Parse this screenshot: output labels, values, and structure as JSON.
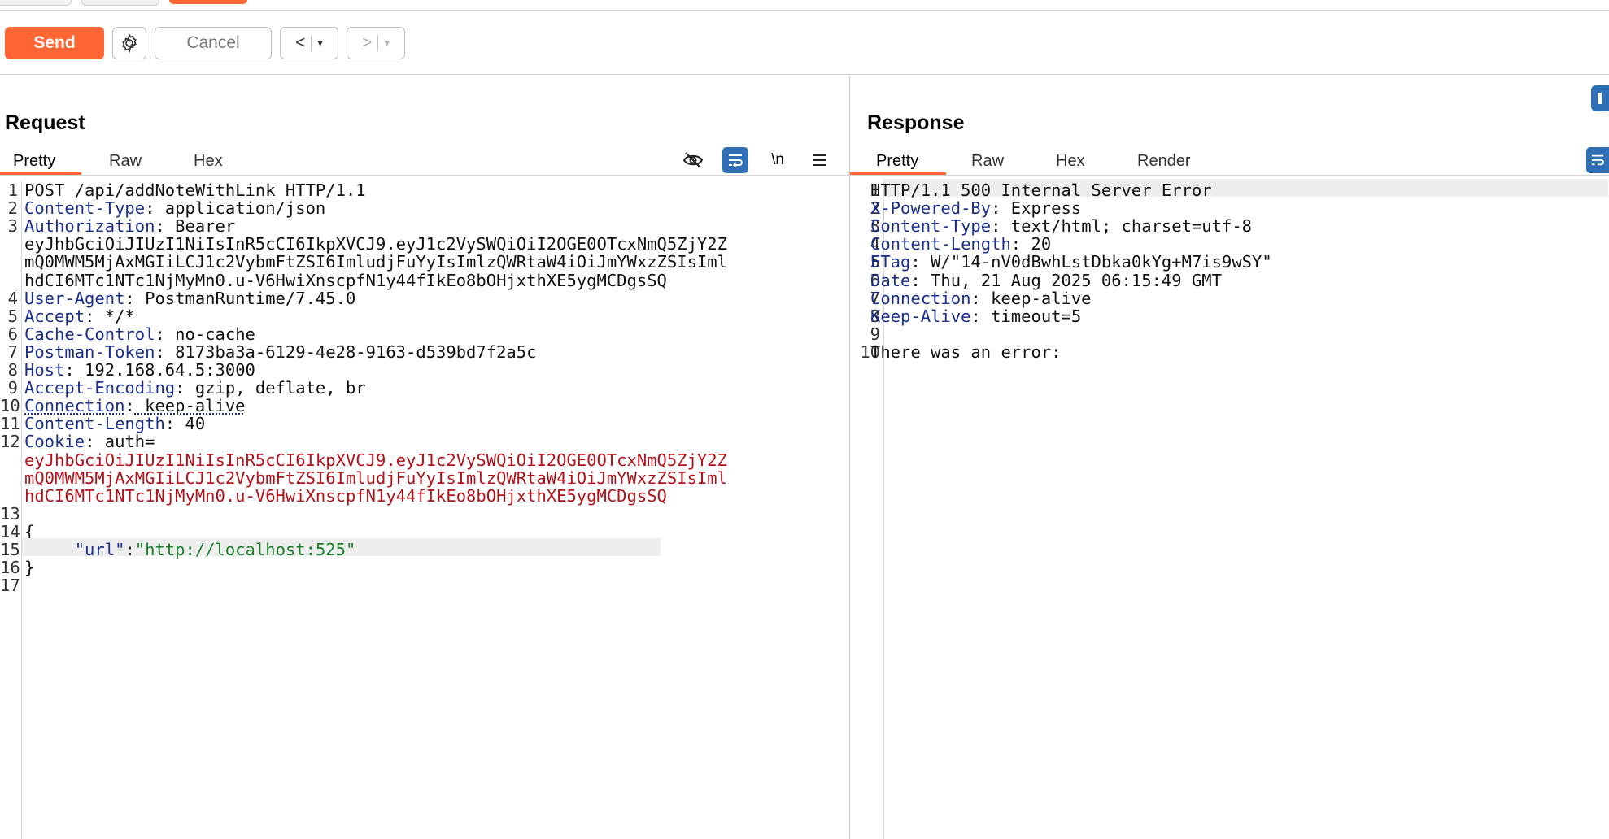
{
  "toolbar": {
    "send_label": "Send",
    "cancel_label": "Cancel",
    "back_glyph": "<",
    "forward_glyph": ">",
    "dropdown_glyph": "▾",
    "settings_icon": "gear-icon"
  },
  "request": {
    "title": "Request",
    "tabs": [
      "Pretty",
      "Raw",
      "Hex"
    ],
    "active_tab": "Pretty",
    "newline_toggle": "\\n",
    "lines": [
      {
        "n": "1",
        "text": "POST /api/addNoteWithLink HTTP/1.1"
      },
      {
        "n": "2",
        "key": "Content-Type",
        "val": " application/json"
      },
      {
        "n": "3",
        "key": "Authorization",
        "val": " Bearer"
      },
      {
        "n": "",
        "val": "eyJhbGciOiJIUzI1NiIsInR5cCI6IkpXVCJ9.eyJ1c2VySWQiOiI2OGE0OTcxNmQ5ZjY2Z"
      },
      {
        "n": "",
        "val": "mQ0MWM5MjAxMGIiLCJ1c2VybmFtZSI6ImludjFuYyIsImlzQWRtaW4iOiJmYWxzZSIsIml"
      },
      {
        "n": "",
        "val": "hdCI6MTc1NTc1NjMyMn0.u-V6HwiXnscpfN1y44fIkEo8bOHjxthXE5ygMCDgsSQ"
      },
      {
        "n": "4",
        "key": "User-Agent",
        "val": " PostmanRuntime/7.45.0"
      },
      {
        "n": "5",
        "key": "Accept",
        "val": " */*"
      },
      {
        "n": "6",
        "key": "Cache-Control",
        "val": " no-cache"
      },
      {
        "n": "7",
        "key": "Postman-Token",
        "val": " 8173ba3a-6129-4e28-9163-d539bd7f2a5c"
      },
      {
        "n": "8",
        "key": "Host",
        "val": " 192.168.64.5:3000"
      },
      {
        "n": "9",
        "key": "Accept-Encoding",
        "val": " gzip, deflate, br"
      },
      {
        "n": "10",
        "key": "Connection",
        "val": " keep-alive"
      },
      {
        "n": "11",
        "key": "Content-Length",
        "val": " 40"
      },
      {
        "n": "12",
        "key": "Cookie",
        "val": " auth="
      },
      {
        "n": "",
        "tok": "eyJhbGciOiJIUzI1NiIsInR5cCI6IkpXVCJ9.eyJ1c2VySWQiOiI2OGE0OTcxNmQ5ZjY2Z"
      },
      {
        "n": "",
        "tok": "mQ0MWM5MjAxMGIiLCJ1c2VybmFtZSI6ImludjFuYyIsImlzQWRtaW4iOiJmYWxzZSIsIml"
      },
      {
        "n": "",
        "tok": "hdCI6MTc1NTc1NjMyMn0.u-V6HwiXnscpfN1y44fIkEo8bOHjxthXE5ygMCDgsSQ"
      },
      {
        "n": "13",
        "text": ""
      },
      {
        "n": "14",
        "text": "{"
      },
      {
        "n": "15",
        "jkey": "\"url\"",
        "jsep": ":",
        "jval": "\"http://localhost:525\""
      },
      {
        "n": "16",
        "text": "}"
      },
      {
        "n": "17",
        "text": ""
      }
    ]
  },
  "response": {
    "title": "Response",
    "tabs": [
      "Pretty",
      "Raw",
      "Hex",
      "Render"
    ],
    "active_tab": "Pretty",
    "lines": [
      {
        "n": "1",
        "text": "HTTP/1.1 500 Internal Server Error"
      },
      {
        "n": "2",
        "key": "X-Powered-By",
        "val": " Express"
      },
      {
        "n": "3",
        "key": "Content-Type",
        "val": " text/html; charset=utf-8"
      },
      {
        "n": "4",
        "key": "Content-Length",
        "val": " 20"
      },
      {
        "n": "5",
        "key": "ETag",
        "val": " W/\"14-nV0dBwhLstDbka0kYg+M7is9wSY\""
      },
      {
        "n": "6",
        "key": "Date",
        "val": " Thu, 21 Aug 2025 06:15:49 GMT"
      },
      {
        "n": "7",
        "key": "Connection",
        "val": " keep-alive"
      },
      {
        "n": "8",
        "key": "Keep-Alive",
        "val": " timeout=5"
      },
      {
        "n": "9",
        "text": ""
      },
      {
        "n": "10",
        "text": "There was an error:"
      }
    ]
  },
  "colors": {
    "accent": "#ff6633",
    "header_key": "#1a2f8c",
    "token": "#b2121a",
    "json_string": "#1b7d2a",
    "toggle_blue": "#2f6fb6"
  }
}
